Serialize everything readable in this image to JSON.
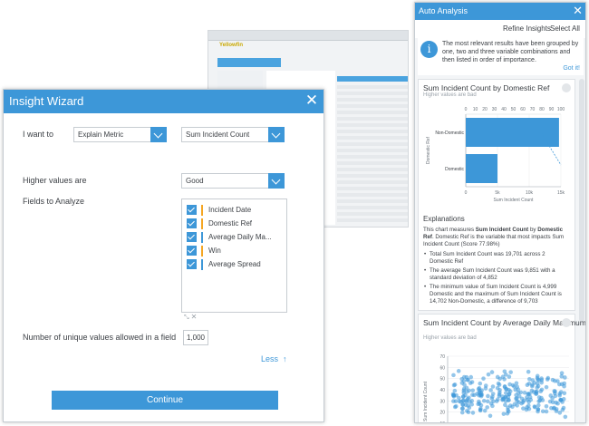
{
  "background_app": {
    "logo": "Yellowfin"
  },
  "wizard": {
    "title": "Insight Wizard",
    "i_want_to_label": "I want to",
    "action_value": "Explain Metric",
    "metric_value": "Sum Incident Count",
    "higher_values_label": "Higher values are",
    "higher_values_value": "Good",
    "fields_label": "Fields to Analyze",
    "fields": [
      {
        "label": "Incident Date",
        "color": "#f5a623"
      },
      {
        "label": "Domestic Ref",
        "color": "#f5a623"
      },
      {
        "label": "Average Daily Ma...",
        "color": "#3d97d8"
      },
      {
        "label": "Win",
        "color": "#f5a623"
      },
      {
        "label": "Average Spread",
        "color": "#3d97d8"
      }
    ],
    "unique_values_label": "Number of unique values allowed in a field",
    "unique_values_value": "1,000",
    "less_label": "Less",
    "continue_label": "Continue"
  },
  "auto_analysis": {
    "title": "Auto Analysis",
    "refine_label": "Refine Insights",
    "select_all_label": "Select All",
    "info_text": "The most relevant results have been grouped by one, two and three variable combinations and then listed in order of importance.",
    "got_it_label": "Got it!",
    "card1": {
      "title": "Sum Incident Count by Domestic Ref",
      "subtitle": "Higher values are bad",
      "explanations_title": "Explanations",
      "explanation_intro_parts": [
        "This chart measures ",
        "Sum Incident Count",
        " by ",
        "Domestic Ref",
        ". Domestic Ref is the variable that most impacts Sum Incident Count (Score 77.98%)"
      ],
      "bullets": [
        "Total Sum Incident Count was 19,701 across 2 Domestic Ref",
        "The average Sum Incident Count was 9,851 with a standard deviation of 4,852",
        "The minimum value of Sum Incident Count is 4,999 Domestic and the maximum of Sum Incident Count is 14,702 Non-Domestic, a difference of 9,703"
      ]
    },
    "card2": {
      "title": "Sum Incident Count by Average Daily Maximum (C)",
      "subtitle": "Higher values are bad"
    }
  },
  "chart_data": [
    {
      "type": "bar",
      "orientation": "horizontal",
      "categories": [
        "Non-Domestic",
        "Domestic"
      ],
      "values": [
        14702,
        4999
      ],
      "top_axis_ticks": [
        "0",
        "10",
        "20",
        "30",
        "40",
        "50",
        "60",
        "70",
        "80",
        "90",
        "100"
      ],
      "bottom_axis_ticks": [
        "0",
        "5k",
        "10k",
        "15k"
      ],
      "xlabel": "Sum Incident Count",
      "ylabel": "Domestic Ref",
      "xlim": [
        0,
        15000
      ],
      "bar_color": "#3d97d8"
    },
    {
      "type": "scatter",
      "xlabel": "",
      "ylabel": "Sum Incident Count",
      "ylim": [
        10,
        70
      ],
      "y_ticks": [
        "10",
        "20",
        "30",
        "40",
        "50",
        "60",
        "70"
      ],
      "point_color": "#3d97d8"
    }
  ]
}
